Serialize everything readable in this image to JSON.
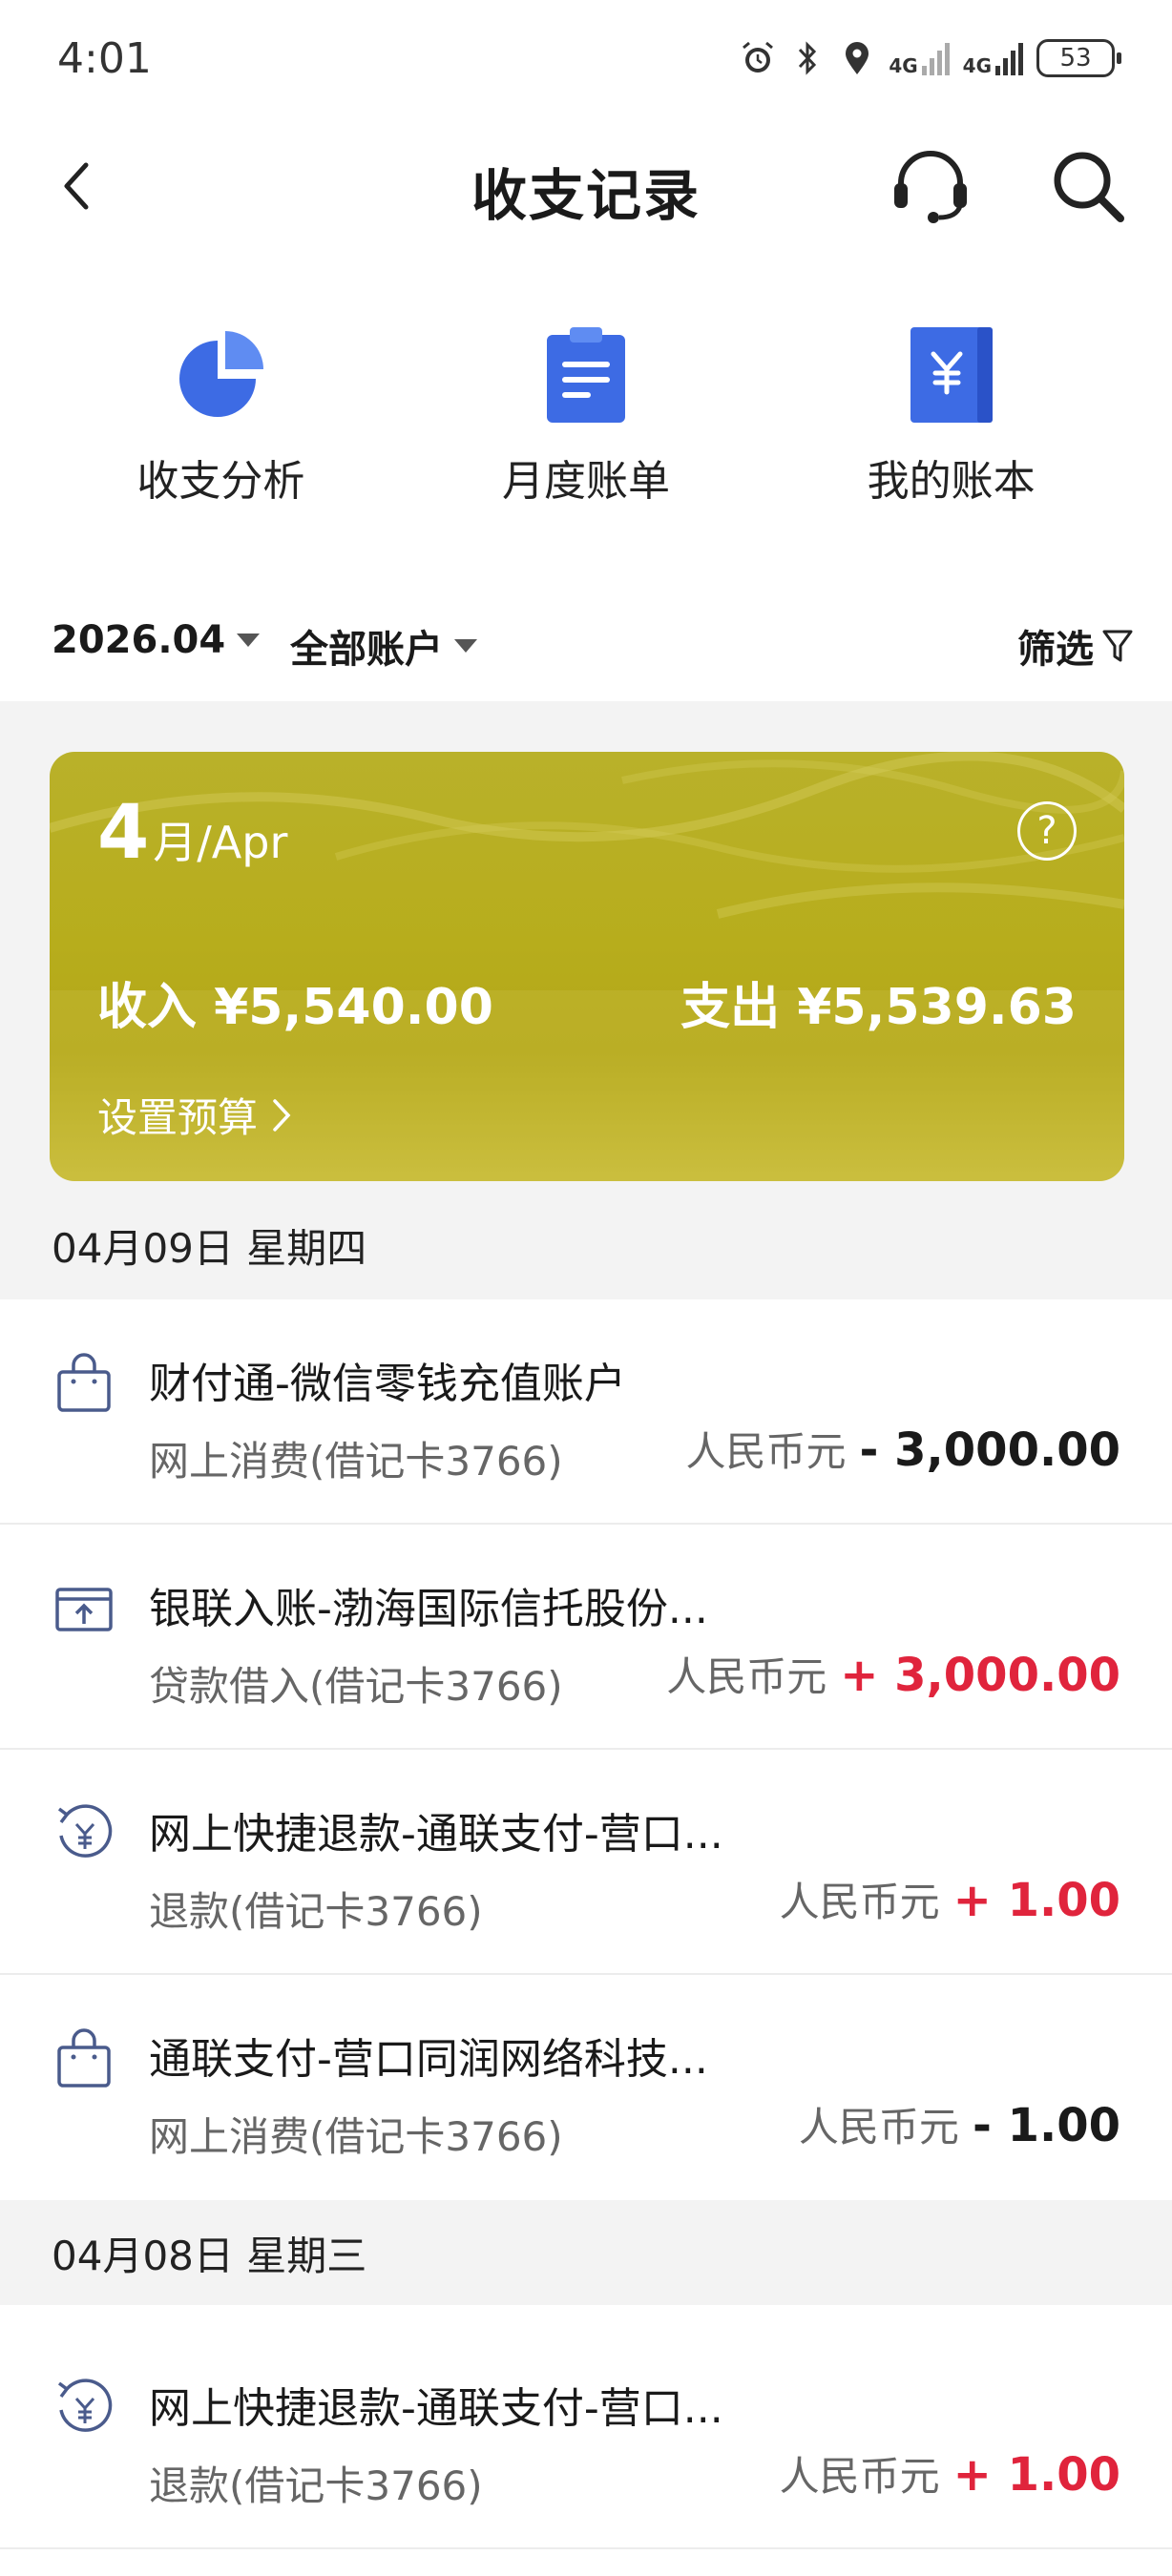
{
  "status_bar": {
    "time": "4:01",
    "signal_1": "4G",
    "signal_2": "4G",
    "battery": "53"
  },
  "header": {
    "title": "收支记录"
  },
  "quick_actions": [
    {
      "label": "收支分析",
      "icon": "pie-chart-icon"
    },
    {
      "label": "月度账单",
      "icon": "clipboard-icon"
    },
    {
      "label": "我的账本",
      "icon": "yuan-book-icon"
    }
  ],
  "filters": {
    "month": "2026.04",
    "account": "全部账户",
    "filter": "筛选"
  },
  "banner": {
    "month_num": "4",
    "month_text": "月/Apr",
    "income": "收入 ¥5,540.00",
    "expense": "支出 ¥5,539.63",
    "budget": "设置预算",
    "help": "?"
  },
  "groups": [
    {
      "date": "04月09日 星期四",
      "transactions": [
        {
          "title": "财付通-微信零钱充值账户",
          "sub": "网上消费(借记卡3766)",
          "currency": "人民币元",
          "amount": "- 3,000.00",
          "type": "neg",
          "icon": "shopping-bag-icon"
        },
        {
          "title": "银联入账-渤海国际信托股份...",
          "sub": "贷款借入(借记卡3766)",
          "currency": "人民币元",
          "amount": "+ 3,000.00",
          "type": "pos",
          "icon": "inbox-upload-icon"
        },
        {
          "title": "网上快捷退款-通联支付-营口...",
          "sub": "退款(借记卡3766)",
          "currency": "人民币元",
          "amount": "+ 1.00",
          "type": "pos",
          "icon": "refund-yuan-icon"
        },
        {
          "title": "通联支付-营口同润网络科技...",
          "sub": "网上消费(借记卡3766)",
          "currency": "人民币元",
          "amount": "- 1.00",
          "type": "neg",
          "icon": "shopping-bag-icon"
        }
      ]
    },
    {
      "date": "04月08日 星期三",
      "transactions": [
        {
          "title": "网上快捷退款-通联支付-营口...",
          "sub": "退款(借记卡3766)",
          "currency": "人民币元",
          "amount": "+ 1.00",
          "type": "pos",
          "icon": "refund-yuan-icon"
        }
      ]
    }
  ]
}
